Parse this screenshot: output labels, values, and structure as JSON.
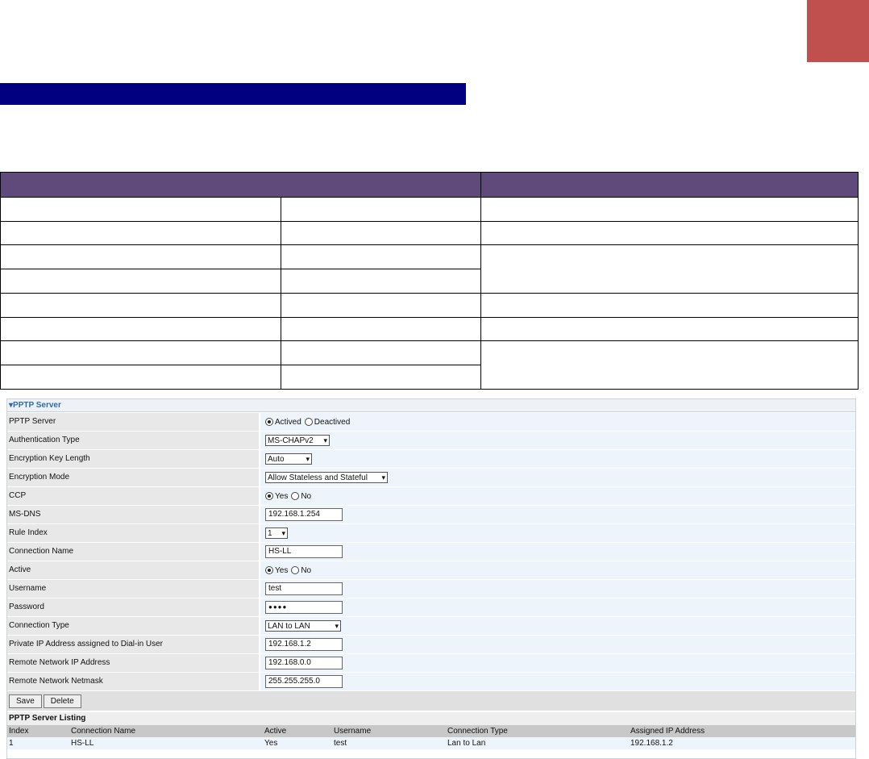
{
  "panel": {
    "title": "▾PPTP Server",
    "rows": [
      {
        "label": "PPTP Server",
        "type": "radio",
        "options": [
          {
            "text": "Actived",
            "checked": true
          },
          {
            "text": "Deactived",
            "checked": false
          }
        ]
      },
      {
        "label": "Authentication Type",
        "type": "select",
        "value": "MS-CHAPv2"
      },
      {
        "label": "Encryption Key Length",
        "type": "select",
        "value": "Auto"
      },
      {
        "label": "Encryption Mode",
        "type": "select",
        "value": "Allow Stateless and Stateful"
      },
      {
        "label": "CCP",
        "type": "radio",
        "options": [
          {
            "text": "Yes",
            "checked": true
          },
          {
            "text": "No",
            "checked": false
          }
        ]
      },
      {
        "label": "MS-DNS",
        "type": "text",
        "value": "192.168.1.254"
      },
      {
        "label": "Rule Index",
        "type": "select",
        "value": "1"
      },
      {
        "label": "Connection Name",
        "type": "text",
        "value": "HS-LL"
      },
      {
        "label": "Active",
        "type": "radio",
        "options": [
          {
            "text": "Yes",
            "checked": true
          },
          {
            "text": "No",
            "checked": false
          }
        ]
      },
      {
        "label": "Username",
        "type": "text",
        "value": "test"
      },
      {
        "label": "Password",
        "type": "text",
        "value": "●●●●"
      },
      {
        "label": "Connection Type",
        "type": "select",
        "value": "LAN to LAN"
      },
      {
        "label": "Private IP Address assigned to Dial-in User",
        "type": "text",
        "value": "192.168.1.2"
      },
      {
        "label": "Remote Network IP Address",
        "type": "text",
        "value": "192.168.0.0"
      },
      {
        "label": "Remote Network Netmask",
        "type": "text",
        "value": "255.255.255.0"
      }
    ],
    "buttons": {
      "save": "Save",
      "delete": "Delete"
    },
    "listing": {
      "title": "PPTP Server Listing",
      "columns": [
        "Index",
        "Connection Name",
        "Active",
        "Username",
        "Connection Type",
        "Assigned IP Address"
      ],
      "rows": [
        [
          "1",
          "HS-LL",
          "Yes",
          "test",
          "Lan to Lan",
          "192.168.1.2"
        ]
      ]
    }
  },
  "colors": {
    "red_tab": "#c0504d",
    "navy_bar": "#000080",
    "table_header": "#604a7b",
    "panel_title": "#2d6ca8"
  }
}
